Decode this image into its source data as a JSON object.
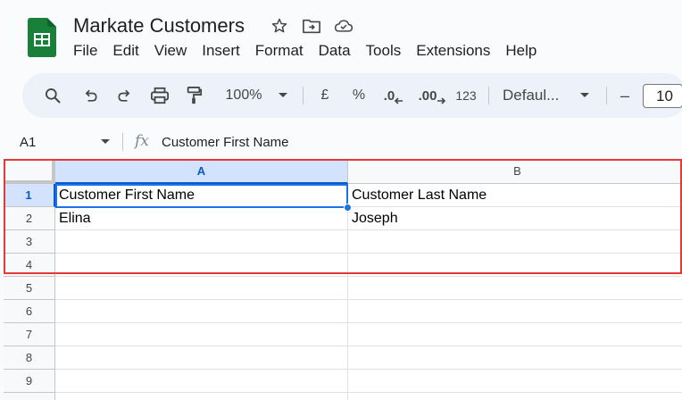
{
  "app": {
    "title": "Markate Customers",
    "brand_color": "#188038"
  },
  "menu": [
    "File",
    "Edit",
    "View",
    "Insert",
    "Format",
    "Data",
    "Tools",
    "Extensions",
    "Help"
  ],
  "toolbar": {
    "zoom": "100%",
    "currency": "£",
    "percent": "%",
    "decrease_decimal": ".0",
    "increase_decimal": ".00",
    "number_format": "123",
    "font": "Defaul...",
    "minus": "–",
    "font_size": "10"
  },
  "formula_bar": {
    "cell_ref": "A1",
    "fx": "fx",
    "content": "Customer First Name"
  },
  "sheet": {
    "columns": [
      "A",
      "B"
    ],
    "selected_column": "A",
    "rows": [
      {
        "num": "1",
        "cells": [
          "Customer First Name",
          "Customer Last Name"
        ]
      },
      {
        "num": "2",
        "cells": [
          "Elina",
          "Joseph"
        ]
      },
      {
        "num": "3",
        "cells": [
          "",
          ""
        ]
      },
      {
        "num": "4",
        "cells": [
          "",
          ""
        ]
      },
      {
        "num": "5",
        "cells": [
          "",
          ""
        ]
      },
      {
        "num": "6",
        "cells": [
          "",
          ""
        ]
      },
      {
        "num": "7",
        "cells": [
          "",
          ""
        ]
      },
      {
        "num": "8",
        "cells": [
          "",
          ""
        ]
      },
      {
        "num": "9",
        "cells": [
          "",
          ""
        ]
      }
    ],
    "active_cell": "A1"
  }
}
